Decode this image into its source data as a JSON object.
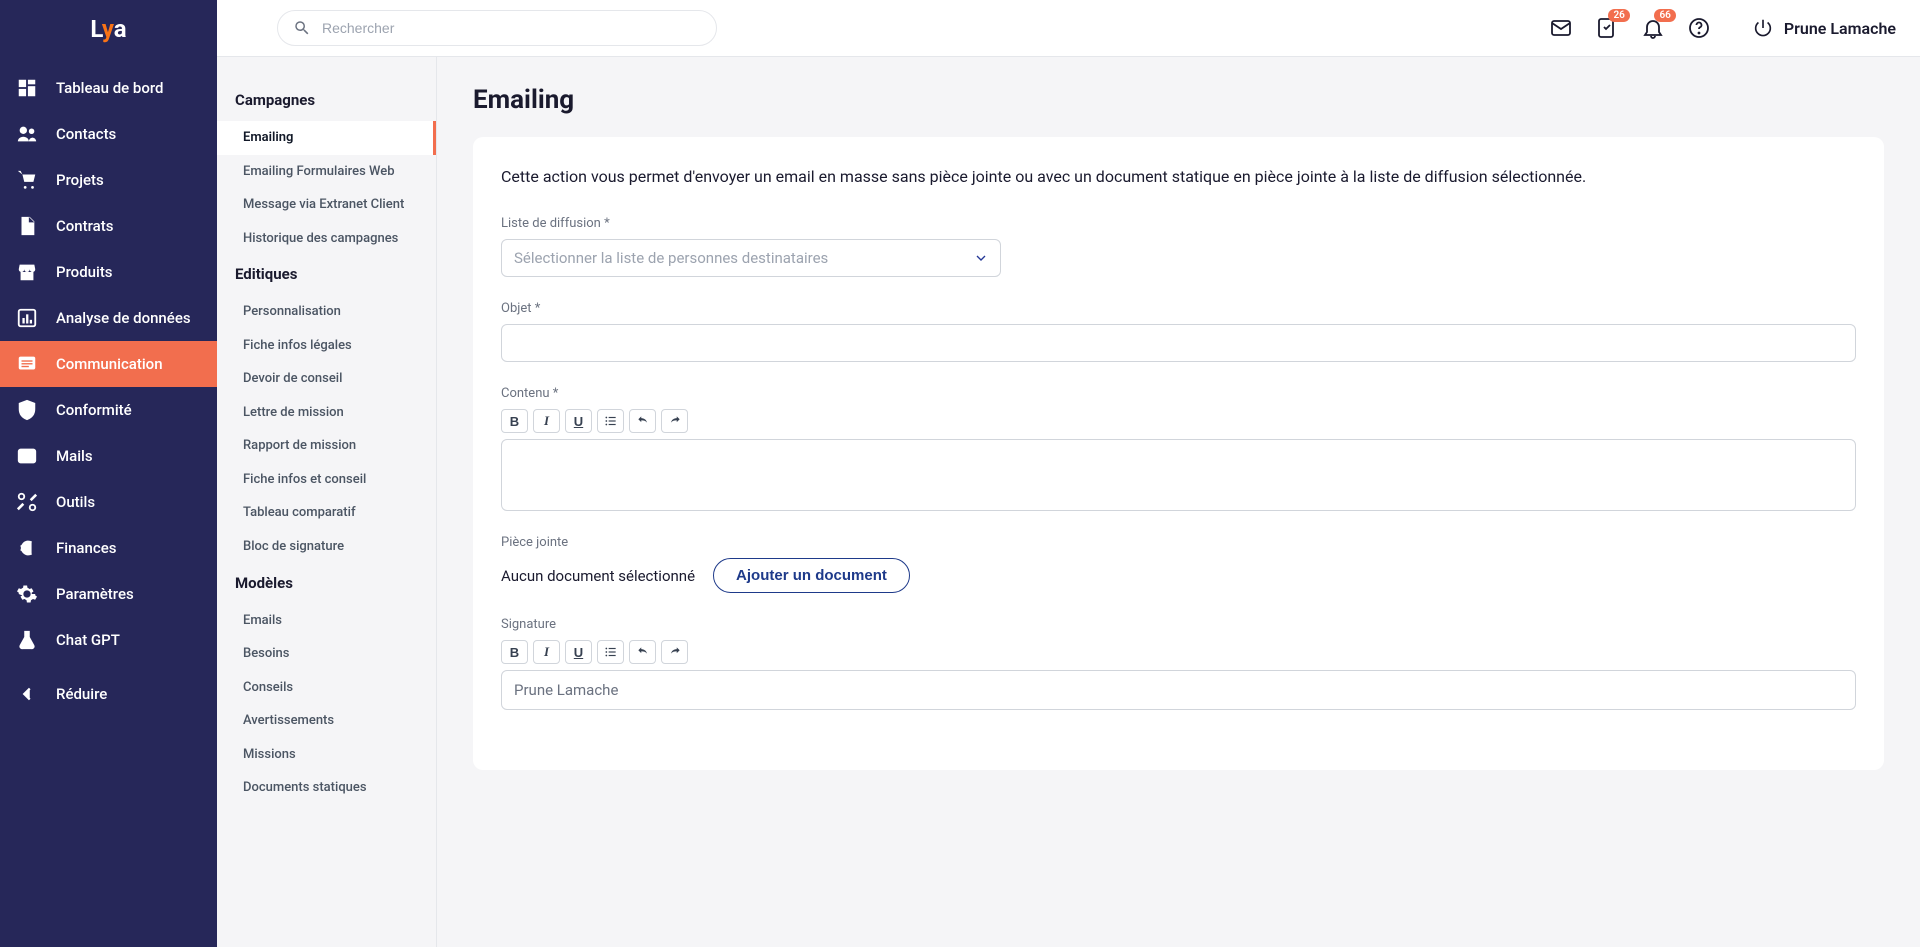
{
  "logo": {
    "part1": "L",
    "part2": "y",
    "part3": "a"
  },
  "search": {
    "placeholder": "Rechercher"
  },
  "topbar": {
    "badge_checklist": "26",
    "badge_notifications": "66",
    "user_name": "Prune Lamache"
  },
  "nav": {
    "items": [
      {
        "label": "Tableau de bord",
        "icon": "dashboard"
      },
      {
        "label": "Contacts",
        "icon": "people"
      },
      {
        "label": "Projets",
        "icon": "cart"
      },
      {
        "label": "Contrats",
        "icon": "document"
      },
      {
        "label": "Produits",
        "icon": "store"
      },
      {
        "label": "Analyse de données",
        "icon": "chart"
      },
      {
        "label": "Communication",
        "icon": "chat"
      },
      {
        "label": "Conformité",
        "icon": "shield"
      },
      {
        "label": "Mails",
        "icon": "mail"
      },
      {
        "label": "Outils",
        "icon": "tools"
      },
      {
        "label": "Finances",
        "icon": "euro"
      },
      {
        "label": "Paramètres",
        "icon": "gear"
      },
      {
        "label": "Chat GPT",
        "icon": "flask"
      }
    ],
    "reduce": {
      "label": "Réduire",
      "icon": "arrow-back"
    }
  },
  "secondary": {
    "groups": [
      {
        "title": "Campagnes",
        "items": [
          {
            "label": "Emailing",
            "active": true
          },
          {
            "label": "Emailing Formulaires Web"
          },
          {
            "label": "Message via Extranet Client"
          },
          {
            "label": "Historique des campagnes"
          }
        ]
      },
      {
        "title": "Editiques",
        "items": [
          {
            "label": "Personnalisation"
          },
          {
            "label": "Fiche infos légales"
          },
          {
            "label": "Devoir de conseil"
          },
          {
            "label": "Lettre de mission"
          },
          {
            "label": "Rapport de mission"
          },
          {
            "label": "Fiche infos et conseil"
          },
          {
            "label": "Tableau comparatif"
          },
          {
            "label": "Bloc de signature"
          }
        ]
      },
      {
        "title": "Modèles",
        "items": [
          {
            "label": "Emails"
          },
          {
            "label": "Besoins"
          },
          {
            "label": "Conseils"
          },
          {
            "label": "Avertissements"
          },
          {
            "label": "Missions"
          },
          {
            "label": "Documents statiques"
          }
        ]
      }
    ]
  },
  "page": {
    "title": "Emailing",
    "intro": "Cette action vous permet d'envoyer un email en masse sans pièce jointe ou avec un document statique en pièce jointe à la liste de diffusion sélectionnée.",
    "fields": {
      "diffusion_label": "Liste de diffusion *",
      "diffusion_placeholder": "Sélectionner la liste de personnes destinataires",
      "subject_label": "Objet *",
      "content_label": "Contenu *",
      "attachment_label": "Pièce jointe",
      "attachment_none": "Aucun document sélectionné",
      "attachment_button": "Ajouter un document",
      "signature_label": "Signature",
      "signature_value": "Prune Lamache"
    }
  }
}
